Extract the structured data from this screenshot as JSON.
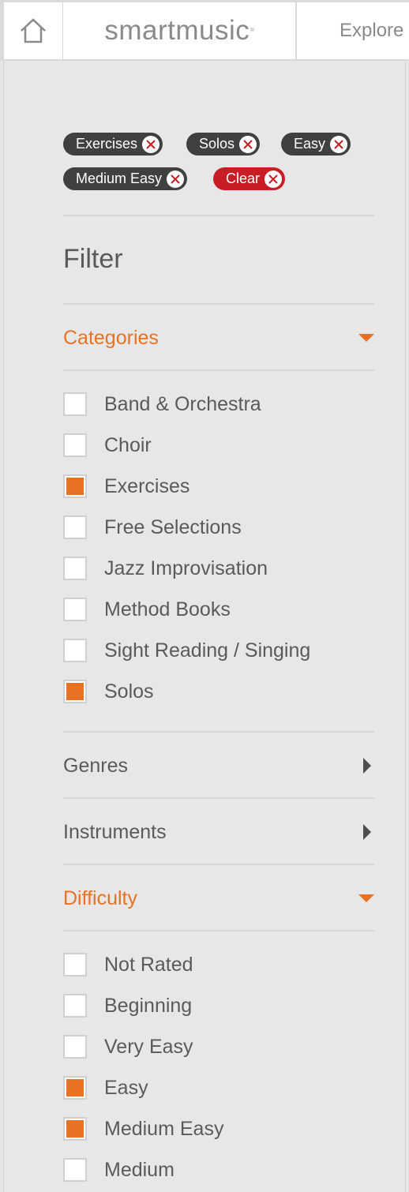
{
  "header": {
    "home_icon": "home-icon",
    "logo_text": "smartmusic",
    "logo_mark": "®",
    "nav_explore": "Explore"
  },
  "active_filters": [
    {
      "label": "Exercises"
    },
    {
      "label": "Solos"
    },
    {
      "label": "Easy"
    },
    {
      "label": "Medium Easy"
    }
  ],
  "clear_label": "Clear",
  "filter_title": "Filter",
  "colors": {
    "accent": "#e87222",
    "chip_dark": "#404040",
    "chip_clear": "#c81d25"
  },
  "sections": {
    "categories": {
      "label": "Categories",
      "expanded": true,
      "options": [
        {
          "label": "Band & Orchestra",
          "checked": false
        },
        {
          "label": "Choir",
          "checked": false
        },
        {
          "label": "Exercises",
          "checked": true
        },
        {
          "label": "Free Selections",
          "checked": false
        },
        {
          "label": "Jazz Improvisation",
          "checked": false
        },
        {
          "label": "Method Books",
          "checked": false
        },
        {
          "label": "Sight Reading / Singing",
          "checked": false
        },
        {
          "label": "Solos",
          "checked": true
        }
      ]
    },
    "genres": {
      "label": "Genres",
      "expanded": false
    },
    "instruments": {
      "label": "Instruments",
      "expanded": false
    },
    "difficulty": {
      "label": "Difficulty",
      "expanded": true,
      "options": [
        {
          "label": "Not Rated",
          "checked": false
        },
        {
          "label": "Beginning",
          "checked": false
        },
        {
          "label": "Very Easy",
          "checked": false
        },
        {
          "label": "Easy",
          "checked": true
        },
        {
          "label": "Medium Easy",
          "checked": true
        },
        {
          "label": "Medium",
          "checked": false
        }
      ]
    }
  }
}
